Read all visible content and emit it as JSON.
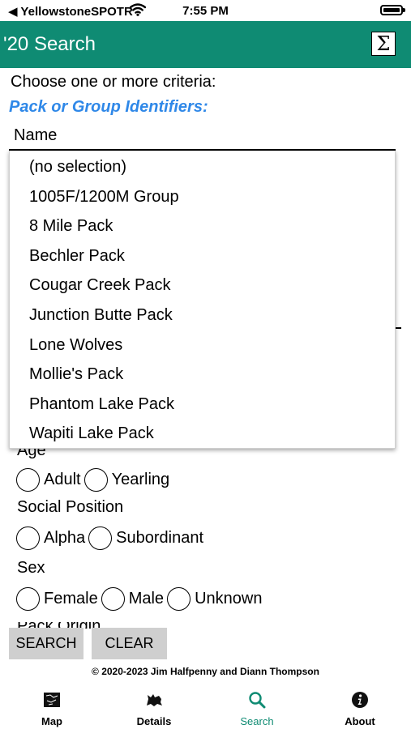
{
  "status_bar": {
    "carrier": "◀ YellowstoneSPOTR",
    "time": "7:55 PM"
  },
  "header": {
    "title": "'20 Search",
    "summary_symbol": "Σ"
  },
  "form": {
    "intro": "Choose one or more criteria:",
    "section_heading": "Pack or Group Identifiers:",
    "name_label": "Name",
    "name_options": [
      "(no selection)",
      "1005F/1200M Group",
      "8 Mile Pack",
      "Bechler Pack",
      "Cougar Creek Pack",
      "Junction Butte Pack",
      "Lone Wolves",
      "Mollie's Pack",
      "Phantom Lake Pack",
      "Wapiti Lake Pack"
    ],
    "age": {
      "label": "Age",
      "options": [
        "Adult",
        "Yearling"
      ]
    },
    "social_position": {
      "label": "Social Position",
      "options": [
        "Alpha",
        "Subordinant"
      ]
    },
    "sex": {
      "label": "Sex",
      "options": [
        "Female",
        "Male",
        "Unknown"
      ]
    },
    "next_label": "Pack Origin"
  },
  "buttons": {
    "search": "SEARCH",
    "clear": "CLEAR"
  },
  "copyright": "© 2020-2023 Jim Halfpenny and Diann Thompson",
  "tabs": [
    {
      "label": "Map",
      "icon": "map-icon"
    },
    {
      "label": "Details",
      "icon": "wolf-icon"
    },
    {
      "label": "Search",
      "icon": "search-icon",
      "active": true
    },
    {
      "label": "About",
      "icon": "info-icon"
    }
  ],
  "colors": {
    "accent": "#0f8b73",
    "heading_blue": "#2f88e8",
    "button_gray": "#cfcfcf"
  }
}
